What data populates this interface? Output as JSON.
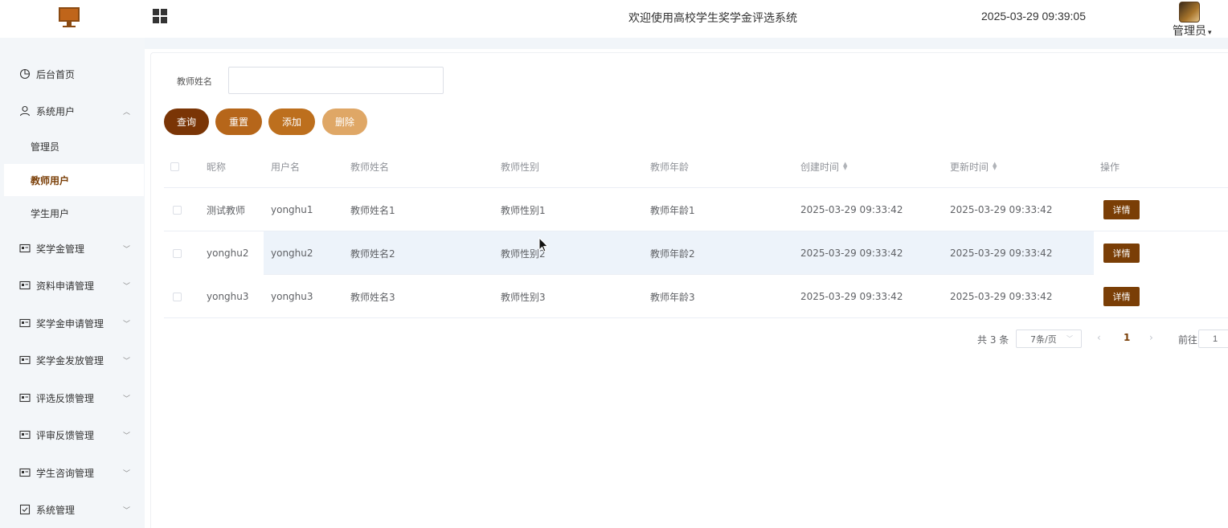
{
  "header": {
    "welcome": "欢迎使用高校学生奖学金评选系统",
    "datetime": "2025-03-29 09:39:05",
    "user": "管理员",
    "caret": "▾"
  },
  "sidebar": {
    "items": [
      {
        "label": "后台首页",
        "icon": "pie-chart-icon"
      },
      {
        "label": "系统用户",
        "icon": "user-icon",
        "expanded": true,
        "children": [
          {
            "label": "管理员"
          },
          {
            "label": "教师用户",
            "active": true
          },
          {
            "label": "学生用户"
          }
        ]
      },
      {
        "label": "奖学金管理",
        "icon": "card-icon"
      },
      {
        "label": "资料申请管理",
        "icon": "card-icon"
      },
      {
        "label": "奖学金申请管理",
        "icon": "card-icon"
      },
      {
        "label": "奖学金发放管理",
        "icon": "card-icon"
      },
      {
        "label": "评选反馈管理",
        "icon": "card-icon"
      },
      {
        "label": "评审反馈管理",
        "icon": "card-icon"
      },
      {
        "label": "学生咨询管理",
        "icon": "card-icon"
      },
      {
        "label": "系统管理",
        "icon": "check-square-icon"
      }
    ]
  },
  "search": {
    "label": "教师姓名",
    "value": ""
  },
  "buttons": {
    "query": "查询",
    "reset": "重置",
    "add": "添加",
    "delete": "删除"
  },
  "table": {
    "headers": [
      "昵称",
      "用户名",
      "教师姓名",
      "教师性别",
      "教师年龄",
      "创建时间",
      "更新时间",
      "操作"
    ],
    "rows": [
      {
        "nickname": "测试教师",
        "username": "yonghu1",
        "name": "教师姓名1",
        "gender": "教师性别1",
        "age": "教师年龄1",
        "created": "2025-03-29 09:33:42",
        "updated": "2025-03-29 09:33:42",
        "action": "详情"
      },
      {
        "nickname": "yonghu2",
        "username": "yonghu2",
        "name": "教师姓名2",
        "gender": "教师性别2",
        "age": "教师年龄2",
        "created": "2025-03-29 09:33:42",
        "updated": "2025-03-29 09:33:42",
        "action": "详情"
      },
      {
        "nickname": "yonghu3",
        "username": "yonghu3",
        "name": "教师姓名3",
        "gender": "教师性别3",
        "age": "教师年龄3",
        "created": "2025-03-29 09:33:42",
        "updated": "2025-03-29 09:33:42",
        "action": "详情"
      }
    ]
  },
  "pagination": {
    "total": "共 3 条",
    "page_size": "7条/页",
    "prev": "‹",
    "current": "1",
    "next": "›",
    "goto_label": "前往",
    "goto_value": "1"
  },
  "colors": {
    "accent_dark": "#7a3506",
    "accent": "#b6661a",
    "accent_light": "#dfa766",
    "sidebar_bg": "#f3f6f9"
  }
}
